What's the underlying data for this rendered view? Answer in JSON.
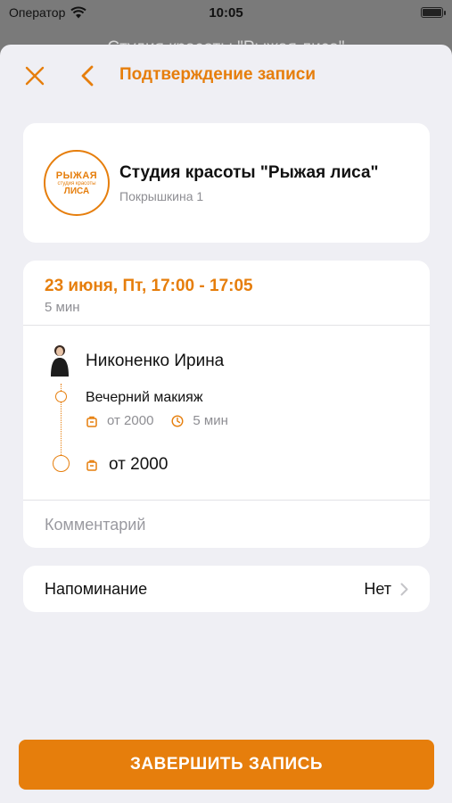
{
  "status_bar": {
    "carrier": "Оператор",
    "time": "10:05"
  },
  "background": {
    "title": "Студия красоты \"Рыжая лиса\""
  },
  "header": {
    "title": "Подтверждение записи"
  },
  "salon": {
    "name": "Студия красоты \"Рыжая лиса\"",
    "address": "Покрышкина 1",
    "logo": {
      "line1": "РЫЖАЯ",
      "line2": "студия красоты",
      "line3": "ЛИСА"
    }
  },
  "booking": {
    "date_time": "23 июня, Пт, 17:00 - 17:05",
    "duration": "5 мин",
    "master_name": "Никоненко Ирина",
    "service": {
      "name": "Вечерний макияж",
      "price": "от 2000",
      "duration": "5 мин"
    },
    "total": "от 2000",
    "comment_placeholder": "Комментарий"
  },
  "reminder": {
    "label": "Напоминание",
    "value": "Нет"
  },
  "finish_button": "ЗАВЕРШИТЬ ЗАПИСЬ",
  "colors": {
    "accent": "#e67e0c",
    "sheet_background": "#efeff4",
    "secondary_text": "#8e8e93"
  }
}
